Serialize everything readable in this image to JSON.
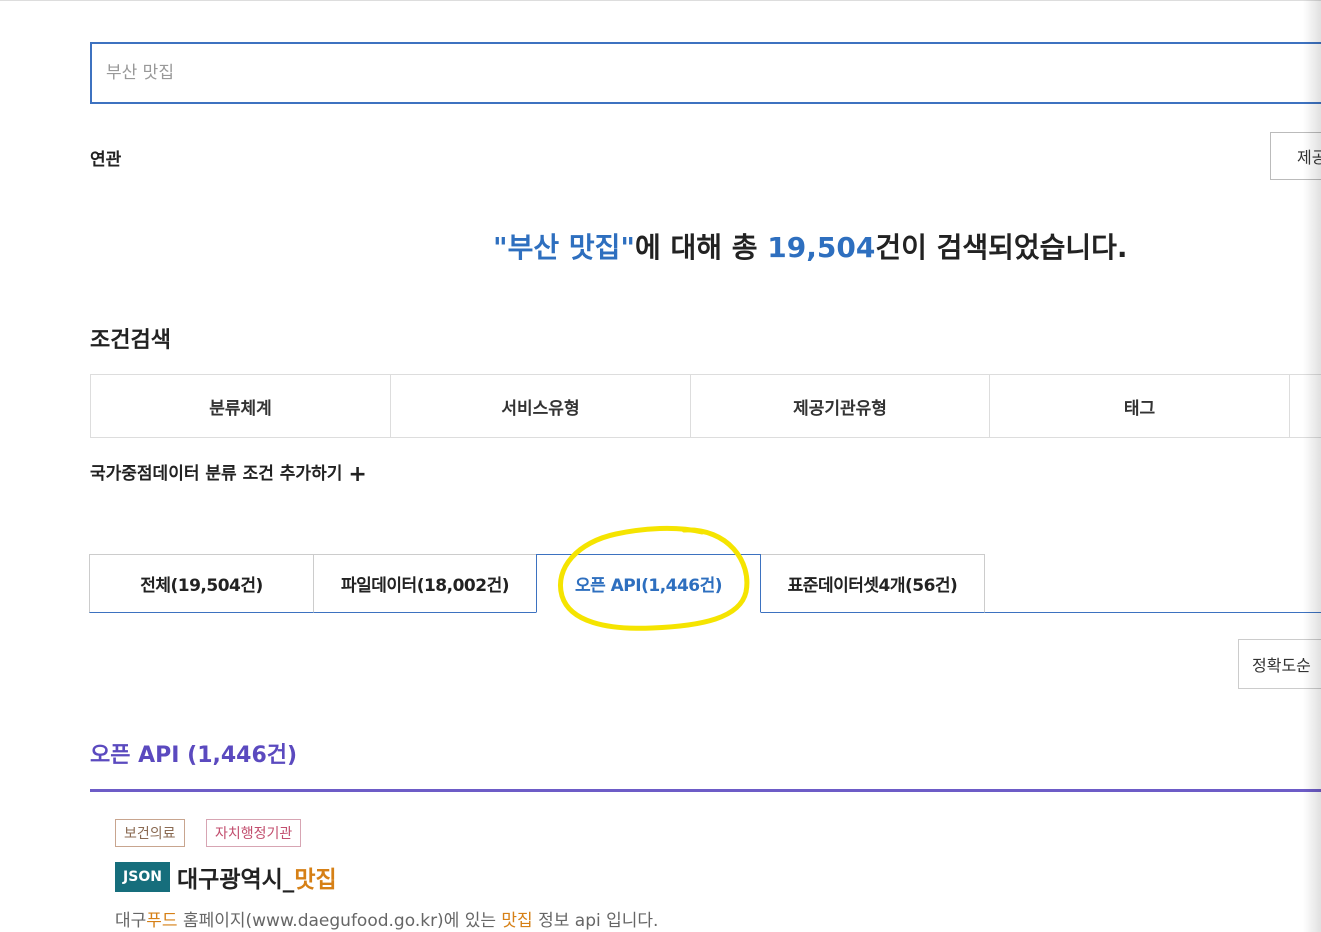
{
  "search": {
    "value": "",
    "placeholder": "부산 맛집"
  },
  "related_label": "연관",
  "provider_filter_label": "제공",
  "summary": {
    "quote_open": "\"",
    "query": "부산 맛집",
    "quote_close": "\"",
    "text_mid": "에 대해 총 ",
    "count": "19,504",
    "text_end": "건이 검색되었습니다."
  },
  "conditions": {
    "title": "조건검색",
    "columns": [
      "분류체계",
      "서비스유형",
      "제공기관유형",
      "태그"
    ],
    "add_label": "국가중점데이터 분류 조건 추가하기",
    "add_icon": "plus-icon"
  },
  "tabs": [
    {
      "label": "전체(19,504건)",
      "active": false
    },
    {
      "label": "파일데이터(18,002건)",
      "active": false
    },
    {
      "label": "오픈 API(1,446건)",
      "active": true
    },
    {
      "label": "표준데이터셋4개(56건)",
      "active": false
    }
  ],
  "annotation": {
    "color": "#f5e400",
    "shape": "hand-drawn-circle"
  },
  "sort": {
    "selected": "정확도순"
  },
  "section": {
    "title": "오픈 API (1,446건)",
    "accent": "#5b4abf"
  },
  "result": {
    "badges": [
      "보건의료",
      "자치행정기관"
    ],
    "format": "JSON",
    "title_prefix": "대구광역시_",
    "title_highlight": "맛집",
    "desc_1": "대구",
    "desc_2": "푸드",
    "desc_3": " 홈페이지(www.daegufood.go.kr)에 있는 ",
    "desc_4": "맛집",
    "desc_5": " 정보 api 입니다."
  },
  "colors": {
    "primary": "#2e6fbf",
    "highlight": "#d68016",
    "json_badge": "#166e7c"
  }
}
